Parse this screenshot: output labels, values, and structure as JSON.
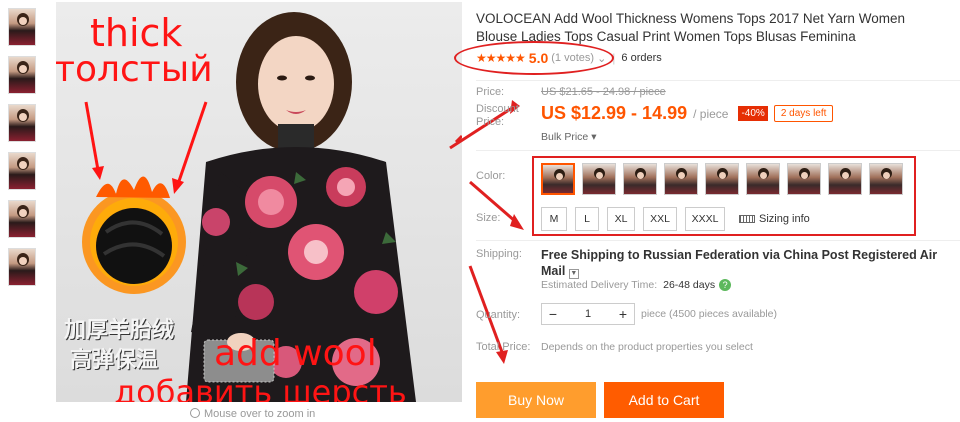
{
  "product": {
    "title": "VOLOCEAN Add Wool Thickness Womens Tops 2017 Net Yarn Women Blouse Ladies Tops Casual Print Women Tops Blusas Feminina",
    "stars": "★★★★★",
    "rating": "5.0",
    "votes": "(1 votes)",
    "orders": "6 orders"
  },
  "image_overlay": {
    "thick_en": "thick",
    "thick_ru": "толстый",
    "cn_line1": "加厚羊胎绒",
    "cn_line2": "高弹保温",
    "wool_en": "add wool",
    "wool_ru": "добавить шерсть",
    "zoom_hint": "Mouse over to zoom in"
  },
  "price": {
    "price_label": "Price:",
    "original": "US $21.65 - 24.98 / piece",
    "discount_label_1": "Discount",
    "discount_label_2": "Price:",
    "current": "US $12.99 - 14.99",
    "unit": "/ piece",
    "discount_badge": "-40%",
    "days_left": "2 days left",
    "bulk_price": "Bulk Price"
  },
  "options": {
    "color_label": "Color:",
    "size_label": "Size:",
    "sizes": [
      "M",
      "L",
      "XL",
      "XXL",
      "XXXL"
    ],
    "sizing_info": "Sizing info"
  },
  "shipping": {
    "label": "Shipping:",
    "main": "Free Shipping to Russian Federation via China Post Registered Air Mail",
    "delivery_label": "Estimated Delivery Time:",
    "delivery_days": "26-48 days"
  },
  "quantity": {
    "label": "Quantity:",
    "minus": "−",
    "value": "1",
    "plus": "+",
    "note": "piece (4500 pieces available)"
  },
  "total": {
    "label": "Total Price:",
    "note": "Depends on the product properties you select"
  },
  "actions": {
    "buy_now": "Buy Now",
    "add_to_cart": "Add to Cart"
  },
  "colors": {
    "accent": "#ff5500",
    "annotation_red": "#e02020",
    "buy_button": "#ff9d2d",
    "cart_button": "#ff5c00"
  }
}
